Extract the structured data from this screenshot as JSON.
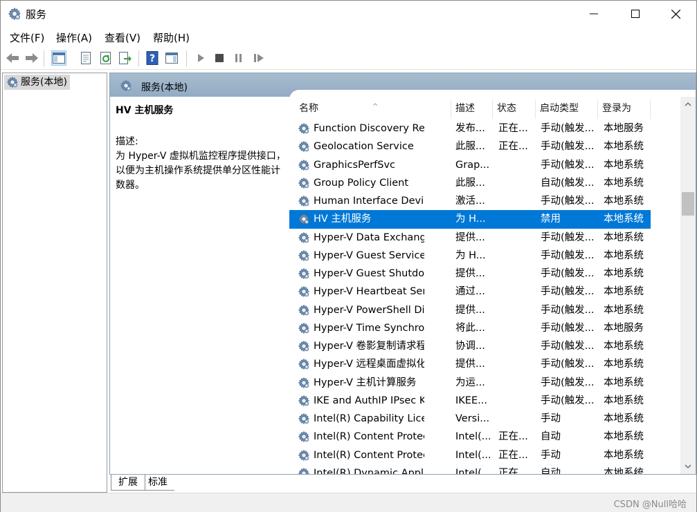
{
  "window": {
    "title": "服务"
  },
  "menu": [
    "文件(F)",
    "操作(A)",
    "查看(V)",
    "帮助(H)"
  ],
  "tree": {
    "root_label": "服务(本地)"
  },
  "panel": {
    "title": "服务(本地)",
    "selected_service_title": "HV 主机服务",
    "desc_label": "描述:",
    "desc_text": "为 Hyper-V 虚拟机监控程序提供接口，以便为主机操作系统提供单分区性能计数器。"
  },
  "columns": {
    "name": "名称",
    "desc": "描述",
    "status": "状态",
    "start": "启动类型",
    "logon": "登录为"
  },
  "rows": [
    {
      "name": "Function Discovery Resour...",
      "desc": "发布...",
      "status": "正在...",
      "start": "手动(触发...",
      "logon": "本地服务"
    },
    {
      "name": "Geolocation Service",
      "desc": "此服...",
      "status": "正在...",
      "start": "手动(触发...",
      "logon": "本地系统"
    },
    {
      "name": "GraphicsPerfSvc",
      "desc": "Grap...",
      "status": "",
      "start": "手动(触发...",
      "logon": "本地系统"
    },
    {
      "name": "Group Policy Client",
      "desc": "此服...",
      "status": "",
      "start": "自动(触发...",
      "logon": "本地系统"
    },
    {
      "name": "Human Interface Device S...",
      "desc": "激活...",
      "status": "",
      "start": "手动(触发...",
      "logon": "本地系统"
    },
    {
      "name": "HV 主机服务",
      "desc": "为 H...",
      "status": "",
      "start": "禁用",
      "logon": "本地系统",
      "selected": true
    },
    {
      "name": "Hyper-V Data Exchange Se...",
      "desc": "提供...",
      "status": "",
      "start": "手动(触发...",
      "logon": "本地系统"
    },
    {
      "name": "Hyper-V Guest Service Int...",
      "desc": "为 H...",
      "status": "",
      "start": "手动(触发...",
      "logon": "本地系统"
    },
    {
      "name": "Hyper-V Guest Shutdown ...",
      "desc": "提供...",
      "status": "",
      "start": "手动(触发...",
      "logon": "本地系统"
    },
    {
      "name": "Hyper-V Heartbeat Service",
      "desc": "通过...",
      "status": "",
      "start": "手动(触发...",
      "logon": "本地系统"
    },
    {
      "name": "Hyper-V PowerShell Direct...",
      "desc": "提供...",
      "status": "",
      "start": "手动(触发...",
      "logon": "本地系统"
    },
    {
      "name": "Hyper-V Time Synchroniza...",
      "desc": "将此...",
      "status": "",
      "start": "手动(触发...",
      "logon": "本地服务"
    },
    {
      "name": "Hyper-V 卷影复制请求程序",
      "desc": "协调...",
      "status": "",
      "start": "手动(触发...",
      "logon": "本地系统"
    },
    {
      "name": "Hyper-V 远程桌面虚拟化服...",
      "desc": "提供...",
      "status": "",
      "start": "手动(触发...",
      "logon": "本地系统"
    },
    {
      "name": "Hyper-V 主机计算服务",
      "desc": "为运...",
      "status": "",
      "start": "手动(触发...",
      "logon": "本地系统"
    },
    {
      "name": "IKE and AuthIP IPsec Keyin...",
      "desc": "IKEE...",
      "status": "",
      "start": "手动(触发...",
      "logon": "本地系统"
    },
    {
      "name": "Intel(R) Capability Licensin...",
      "desc": "Versi...",
      "status": "",
      "start": "手动",
      "logon": "本地系统"
    },
    {
      "name": "Intel(R) Content Protection...",
      "desc": "Intel(...",
      "status": "正在...",
      "start": "自动",
      "logon": "本地系统"
    },
    {
      "name": "Intel(R) Content Protection...",
      "desc": "Intel(...",
      "status": "正在...",
      "start": "手动",
      "logon": "本地系统"
    },
    {
      "name": "Intel(R) Dynamic Applicati...",
      "desc": "Intel(...",
      "status": "正在...",
      "start": "自动",
      "logon": "本地系统"
    }
  ],
  "tabs": {
    "extended": "扩展",
    "standard": "标准"
  },
  "watermark": "CSDN @Null哈哈",
  "colors": {
    "selection": "#0078d7",
    "panel_header": "#9fb5ca"
  }
}
